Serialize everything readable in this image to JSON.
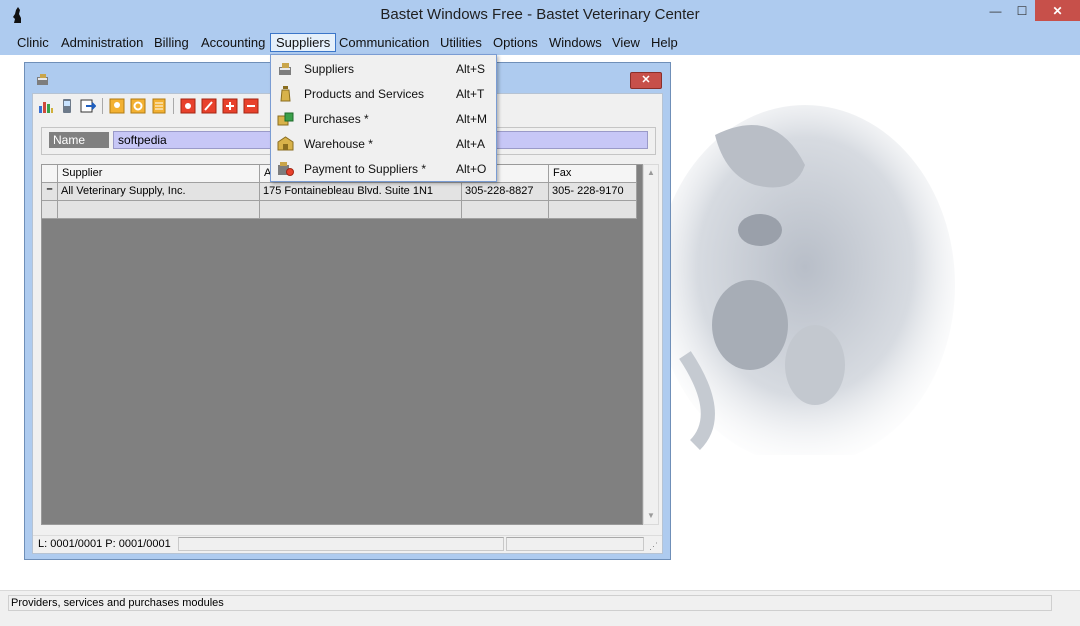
{
  "window": {
    "title": "Bastet Windows Free - Bastet Veterinary Center",
    "minimize": "—",
    "maximize": "☐",
    "close": "✕"
  },
  "menu": {
    "items": [
      "Clinic",
      "Administration",
      "Billing",
      "Accounting",
      "Suppliers",
      "Communication",
      "Utilities",
      "Options",
      "Windows",
      "View",
      "Help"
    ],
    "active": "Suppliers"
  },
  "suppliers_menu": [
    {
      "label": "Suppliers",
      "shortcut": "Alt+S",
      "icon": "supplier-icon"
    },
    {
      "label": "Products and Services",
      "shortcut": "Alt+T",
      "icon": "bottle-icon"
    },
    {
      "label": "Purchases *",
      "shortcut": "Alt+M",
      "icon": "purchases-icon"
    },
    {
      "label": "Warehouse *",
      "shortcut": "Alt+A",
      "icon": "warehouse-icon"
    },
    {
      "label": "Payment to Suppliers *",
      "shortcut": "Alt+O",
      "icon": "payment-icon"
    }
  ],
  "child_window": {
    "close": "✕",
    "name_label": "Name",
    "name_value": "softpedia",
    "grid": {
      "columns": [
        "Supplier",
        "A",
        "",
        "Fax"
      ],
      "rows": [
        {
          "indicator": "–",
          "cells": [
            "All Veterinary Supply, Inc.",
            "175 Fontainebleau Blvd. Suite 1N1",
            "305-228-8827",
            "305- 228-9170"
          ]
        },
        {
          "indicator": "",
          "cells": [
            "",
            "",
            "",
            ""
          ]
        }
      ]
    },
    "scroll_up": "▲",
    "scroll_down": "▼",
    "status": "L: 0001/0001  P: 0001/0001",
    "grip": "⋰"
  },
  "toolbar_icons": [
    "chart-icon",
    "phone-icon",
    "export-icon",
    "award-icon",
    "settings-icon",
    "notes-icon",
    "record-icon",
    "edit-icon",
    "add-icon",
    "remove-icon"
  ],
  "status_bar": {
    "text": "Providers, services and purchases modules"
  }
}
